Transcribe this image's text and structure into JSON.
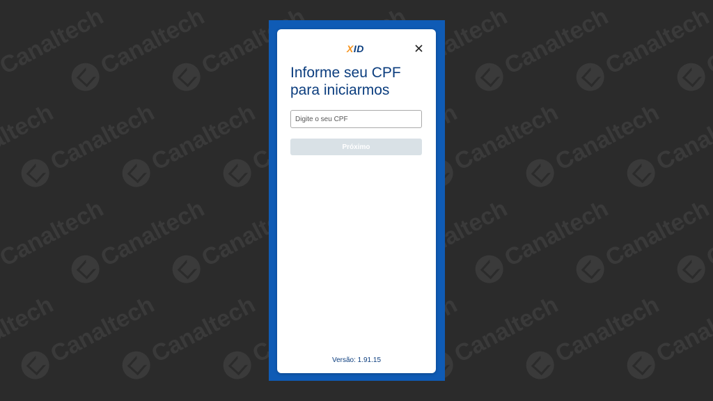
{
  "watermark": {
    "text": "Canaltech"
  },
  "app": {
    "logo_x": "X",
    "logo_id": "ID",
    "close_label": "×",
    "title_line1": "Informe seu CPF",
    "title_line2": "para iniciarmos",
    "cpf_placeholder": "Digite o seu CPF",
    "cpf_value": "",
    "next_button": "Próximo",
    "version": "Versão: 1.91.15"
  },
  "colors": {
    "frame": "#0f5bb5",
    "primary_text": "#0b3d7e",
    "logo_accent": "#f7941d",
    "disabled_button": "#d9e1e6"
  }
}
